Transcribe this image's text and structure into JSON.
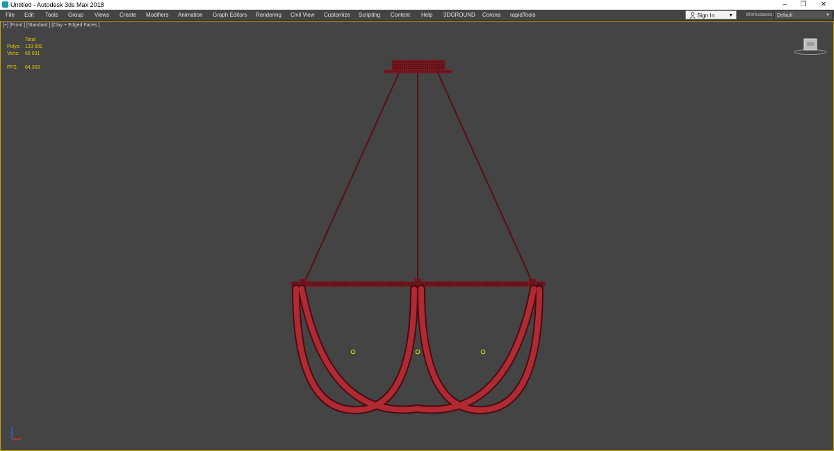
{
  "window": {
    "title": "Untitled - Autodesk 3ds Max 2018",
    "controls": [
      "–",
      "❐",
      "✕"
    ]
  },
  "menu": {
    "items": [
      "File",
      "Edit",
      "Tools",
      "Group",
      "Views",
      "Create",
      "Modifiers",
      "Animation",
      "Graph Editors",
      "Rendering",
      "Civil View",
      "Customize",
      "Scripting",
      "Content",
      "Help",
      "3DGROUND",
      "Corona",
      "rapidTools"
    ]
  },
  "account": {
    "signin_label": "Sign In",
    "workspaces_label": "Workspaces:",
    "workspace_value": "Default"
  },
  "viewport": {
    "label": "[+] [Front ] [Standard ] [Clay + Edged Faces ]",
    "stats": {
      "header": "Total",
      "polys_label": "Polys:",
      "polys_value": "133 600",
      "verts_label": "Verts:",
      "verts_value": "68 031",
      "fps_label": "FPS:",
      "fps_value": "64,303"
    }
  },
  "colors": {
    "viewport_bg": "#444444",
    "viewport_border": "#c8a100",
    "model_wire": "#8a1a22",
    "stats_text": "#e0d000"
  }
}
